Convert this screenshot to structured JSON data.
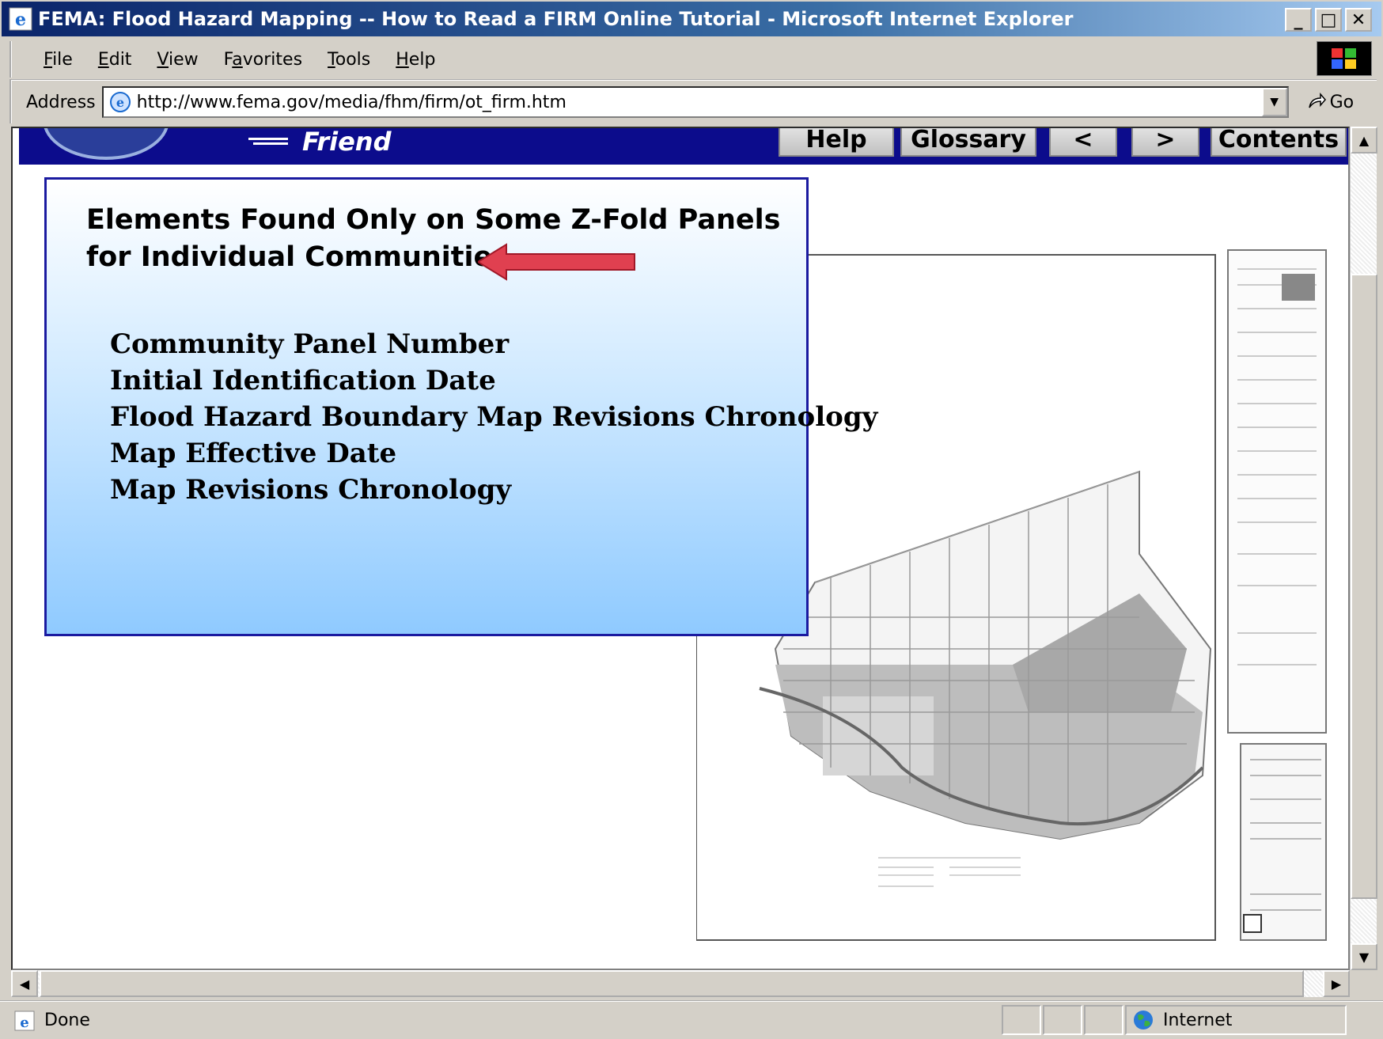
{
  "window": {
    "title": "FEMA: Flood Hazard Mapping -- How to Read a FIRM Online Tutorial - Microsoft Internet Explorer",
    "min_label": "_",
    "max_label": "□",
    "close_label": "✕"
  },
  "menu": {
    "items": [
      {
        "accel": "F",
        "rest": "ile"
      },
      {
        "accel": "E",
        "rest": "dit"
      },
      {
        "accel": "V",
        "rest": "iew"
      },
      {
        "pre": "F",
        "accel": "a",
        "rest": "vorites"
      },
      {
        "accel": "T",
        "rest": "ools"
      },
      {
        "accel": "H",
        "rest": "elp"
      }
    ]
  },
  "address": {
    "label": "Address",
    "url": "http://www.fema.gov/media/fhm/firm/ot_firm.htm",
    "go_label": "Go"
  },
  "header": {
    "tell_friend": "Friend",
    "nav": {
      "help": "Help",
      "glossary": "Glossary",
      "prev": "<",
      "next": ">",
      "contents": "Contents"
    }
  },
  "panel": {
    "title_line1": "Elements Found Only on Some Z-Fold Panels",
    "title_line2": "for Individual Communities",
    "items": [
      "Community Panel Number",
      "Initial Identification Date",
      "Flood Hazard Boundary Map Revisions Chronology",
      "Map Effective Date",
      "Map Revisions Chronology"
    ],
    "arrow_color": "#e04050"
  },
  "status": {
    "text": "Done",
    "zone": "Internet"
  }
}
